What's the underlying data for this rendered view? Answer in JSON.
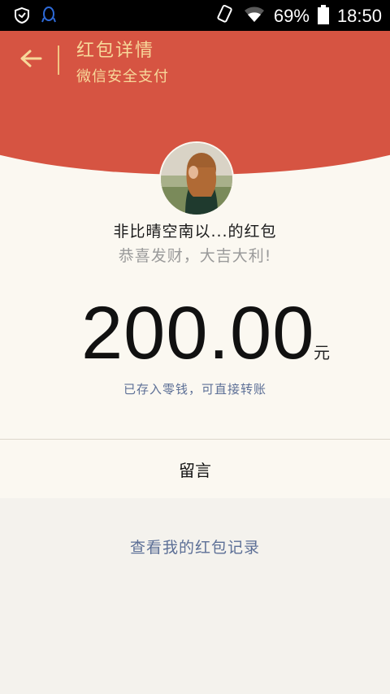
{
  "status_bar": {
    "battery_percent": "69%",
    "time": "18:50",
    "icons": [
      "shield-icon",
      "qq-icon",
      "rotate-icon",
      "wifi-icon",
      "battery-icon"
    ]
  },
  "header": {
    "title": "红包详情",
    "subtitle": "微信安全支付",
    "accent_color": "#d65442",
    "text_color": "#f7d89a"
  },
  "red_packet": {
    "sender": "非比晴空南以...的红包",
    "greeting": "恭喜发财，大吉大利!",
    "amount": "200.00",
    "unit": "元",
    "note": "已存入零钱，可直接转账"
  },
  "message": {
    "label": "留言"
  },
  "footer": {
    "records_link": "查看我的红包记录"
  }
}
